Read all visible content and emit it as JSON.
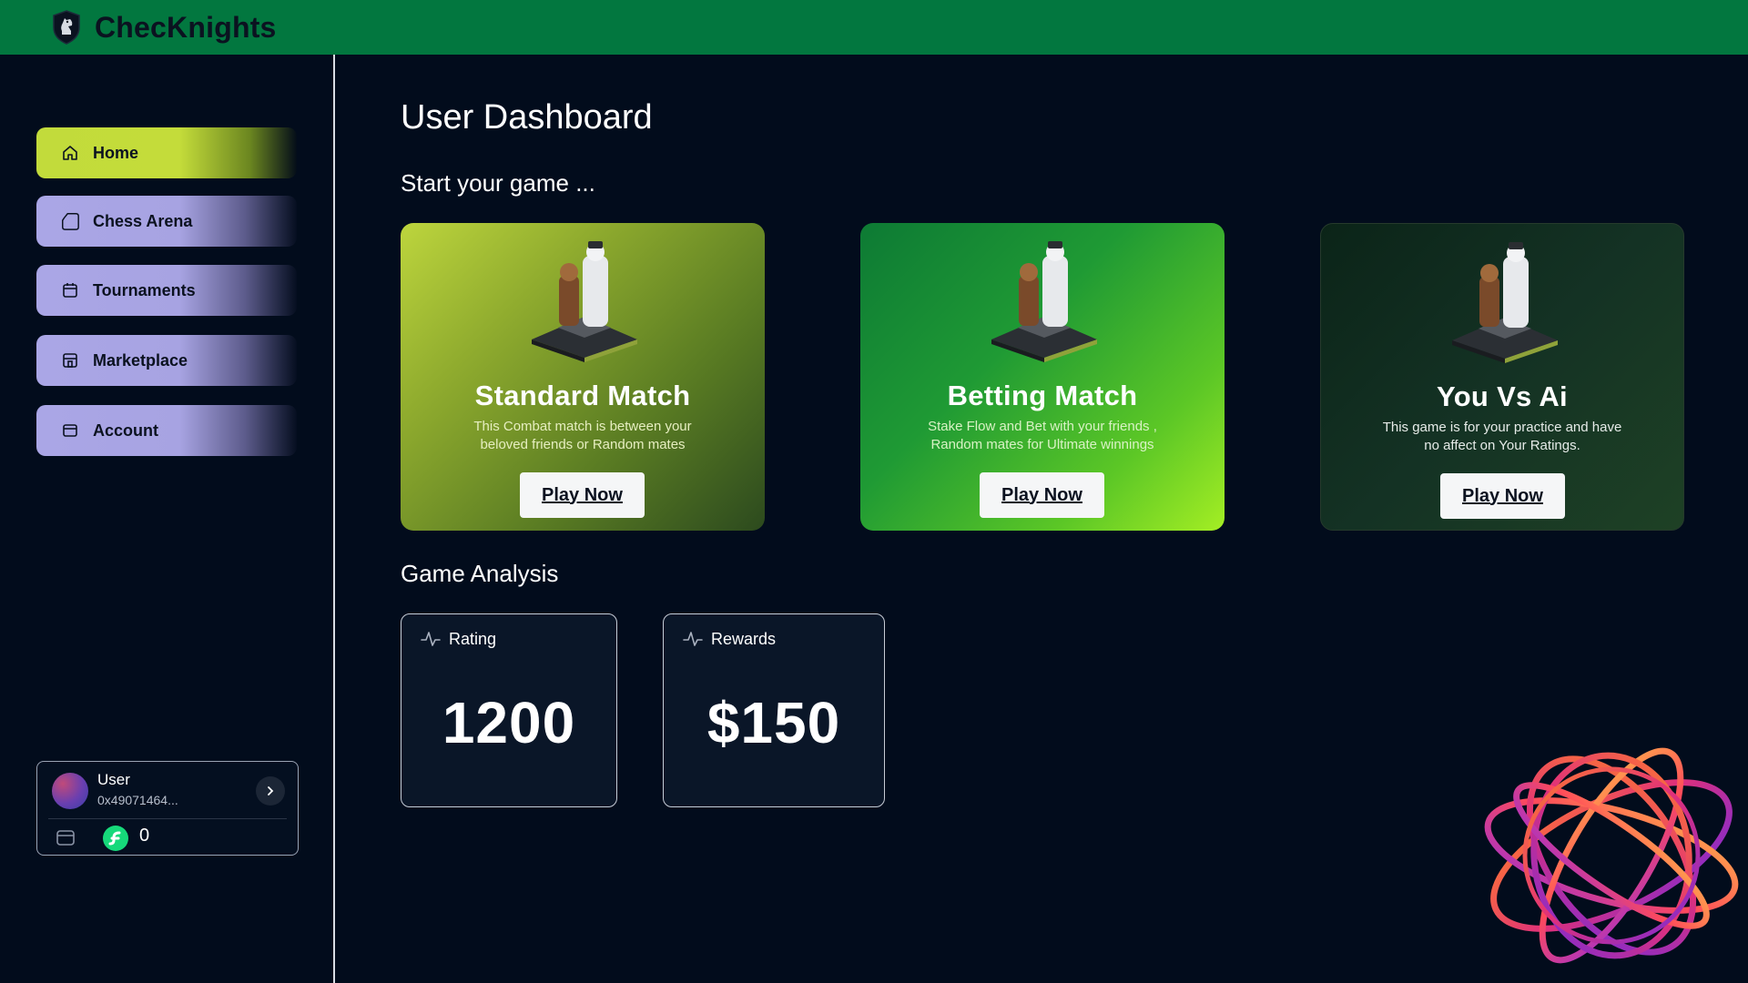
{
  "app": {
    "brand": "ChecKnights"
  },
  "sidebar": {
    "items": [
      {
        "label": "Home",
        "icon": "home-icon",
        "active": true
      },
      {
        "label": "Chess Arena",
        "icon": "chess-arena-icon",
        "active": false
      },
      {
        "label": "Tournaments",
        "icon": "calendar-icon",
        "active": false
      },
      {
        "label": "Marketplace",
        "icon": "store-icon",
        "active": false
      },
      {
        "label": "Account",
        "icon": "wallet-icon",
        "active": false
      }
    ],
    "user": {
      "name": "User",
      "address": "0x49071464...",
      "balance": "0"
    }
  },
  "main": {
    "title": "User Dashboard",
    "start_heading": "Start your game ...",
    "games": [
      {
        "title": "Standard Match",
        "description": "This Combat match is between your beloved friends or Random mates",
        "button": "Play Now"
      },
      {
        "title": "Betting Match",
        "description": "Stake Flow and Bet with your friends , Random mates for Ultimate winnings",
        "button": "Play Now"
      },
      {
        "title": "You Vs Ai",
        "description": "This game is for your practice and have no affect on Your Ratings.",
        "button": "Play Now"
      }
    ],
    "analysis_heading": "Game Analysis",
    "stats": [
      {
        "label": "Rating",
        "value": "1200"
      },
      {
        "label": "Rewards",
        "value": "$150"
      }
    ]
  },
  "colors": {
    "topbar": "#02773f",
    "background": "#020c1c",
    "nav_active": "#c2db3b",
    "nav_inactive": "#aaa6e6"
  }
}
